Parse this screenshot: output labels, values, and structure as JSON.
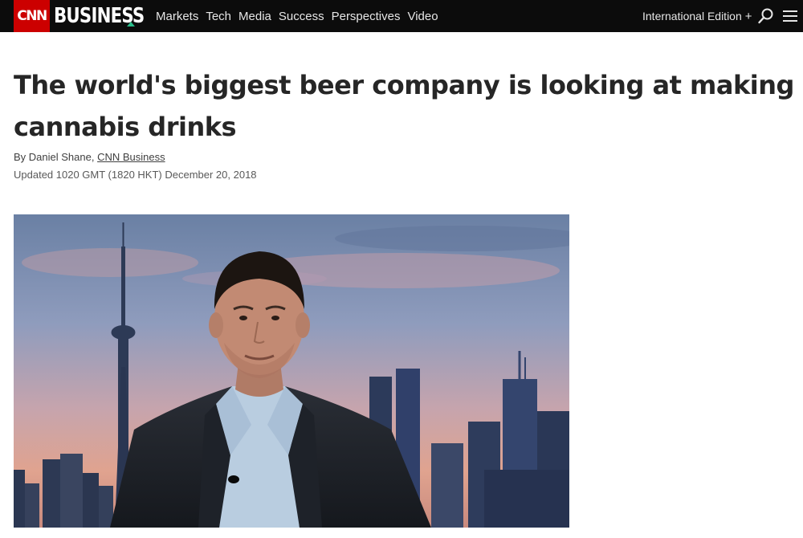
{
  "header": {
    "logo_cnn": "CNN",
    "logo_section": "BUSINESS",
    "nav": [
      "Markets",
      "Tech",
      "Media",
      "Success",
      "Perspectives",
      "Video"
    ],
    "edition_label": "International Edition",
    "edition_plus": "+"
  },
  "article": {
    "headline": "The world's biggest beer company is looking at making cannabis drinks",
    "byline_prefix": "By Daniel Shane, ",
    "byline_link": "CNN Business",
    "updated": "Updated 1020 GMT (1820 HKT) December 20, 2018"
  },
  "icons": {
    "search": "search-icon",
    "menu": "hamburger-menu-icon"
  },
  "colors": {
    "topbar": "#0c0c0c",
    "brand_red": "#cc0000",
    "accent_green": "#2bbf8c"
  }
}
